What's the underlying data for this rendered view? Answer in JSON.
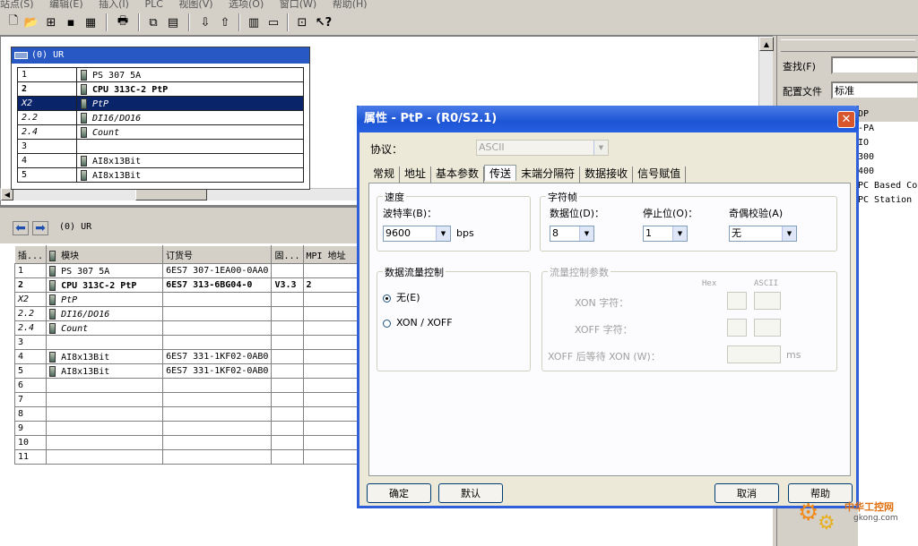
{
  "menu": {
    "items": [
      "站点(S)",
      "编辑(E)",
      "插入(I)",
      "PLC",
      "视图(V)",
      "选项(O)",
      "窗口(W)",
      "帮助(H)"
    ]
  },
  "station": {
    "rack_title": "(0) UR",
    "rows": [
      {
        "slot": "1",
        "module": "PS 307 5A"
      },
      {
        "slot": "2",
        "module": "CPU 313C-2 PtP"
      },
      {
        "slot": "X2",
        "module": "PtP"
      },
      {
        "slot": "2.2",
        "module": "DI16/DO16"
      },
      {
        "slot": "2.4",
        "module": "Count"
      },
      {
        "slot": "3",
        "module": ""
      },
      {
        "slot": "4",
        "module": "AI8x13Bit"
      },
      {
        "slot": "5",
        "module": "AI8x13Bit"
      }
    ]
  },
  "detail": {
    "rack_label": "(0)   UR",
    "columns": [
      "插...",
      "模块",
      "订货号",
      "固...",
      "MPI 地址",
      "I"
    ],
    "rows": [
      {
        "slot": "1",
        "module": "PS 307 5A",
        "order": "6ES7 307-1EA00-0AA0",
        "fw": "",
        "mpi": "",
        "i": ""
      },
      {
        "slot": "2",
        "module": "CPU 313C-2 PtP",
        "order": "6ES7 313-6BG04-0",
        "fw": "V3.3",
        "mpi": "2",
        "i": ""
      },
      {
        "slot": "X2",
        "module": "PtP",
        "order": "",
        "fw": "",
        "mpi": "",
        "i": "10"
      },
      {
        "slot": "2.2",
        "module": "DI16/DO16",
        "order": "",
        "fw": "",
        "mpi": "",
        "i": "0."
      },
      {
        "slot": "2.4",
        "module": "Count",
        "order": "",
        "fw": "",
        "mpi": "",
        "i": "76"
      },
      {
        "slot": "3",
        "module": "",
        "order": "",
        "fw": "",
        "mpi": "",
        "i": ""
      },
      {
        "slot": "4",
        "module": "AI8x13Bit",
        "order": "6ES7 331-1KF02-0AB0",
        "fw": "",
        "mpi": "",
        "i": "30"
      },
      {
        "slot": "5",
        "module": "AI8x13Bit",
        "order": "6ES7 331-1KF02-0AB0",
        "fw": "",
        "mpi": "",
        "i": "31"
      },
      {
        "slot": "6",
        "module": "",
        "order": "",
        "fw": "",
        "mpi": "",
        "i": ""
      },
      {
        "slot": "7",
        "module": "",
        "order": "",
        "fw": "",
        "mpi": "",
        "i": ""
      },
      {
        "slot": "8",
        "module": "",
        "order": "",
        "fw": "",
        "mpi": "",
        "i": ""
      },
      {
        "slot": "9",
        "module": "",
        "order": "",
        "fw": "",
        "mpi": "",
        "i": ""
      },
      {
        "slot": "10",
        "module": "",
        "order": "",
        "fw": "",
        "mpi": "",
        "i": ""
      },
      {
        "slot": "11",
        "module": "",
        "order": "",
        "fw": "",
        "mpi": "",
        "i": ""
      }
    ]
  },
  "catalog": {
    "find_label": "查找(F)",
    "profile_label": "配置文件",
    "profile_value": "标准",
    "tree": [
      "DP",
      "-PA",
      "IO",
      "300",
      "400",
      "PC Based Co",
      "PC Station"
    ]
  },
  "dialog": {
    "title": "属性 - PtP - (R0/S2.1)",
    "protocol_label": "协议：",
    "protocol_value": "ASCII",
    "tabs": [
      "常规",
      "地址",
      "基本参数",
      "传送",
      "末端分隔符",
      "数据接收",
      "信号赋值"
    ],
    "active_tab": "传送",
    "speed": {
      "group": "速度",
      "baud_label": "波特率(B)：",
      "baud_value": "9600",
      "unit": "bps"
    },
    "frame": {
      "group": "字符帧",
      "data_bits_label": "数据位(D)：",
      "data_bits_value": "8",
      "stop_bits_label": "停止位(O)：",
      "stop_bits_value": "1",
      "parity_label": "奇偶校验(A)",
      "parity_value": "无"
    },
    "flow": {
      "group": "数据流量控制",
      "none_label": "无(E)",
      "xon_label": "XON / XOFF"
    },
    "flow_params": {
      "group": "流量控制参数",
      "hex": "Hex",
      "ascii": "ASCII",
      "xon_label": "XON 字符：",
      "xoff_label": "XOFF 字符：",
      "wait_label": "XOFF 后等待 XON (W)：",
      "wait_unit": "ms"
    },
    "buttons": {
      "ok": "确定",
      "default": "默认",
      "cancel": "取消",
      "help": "帮助"
    }
  },
  "watermark": {
    "text": "中华工控网",
    "url": "gkong.com"
  }
}
